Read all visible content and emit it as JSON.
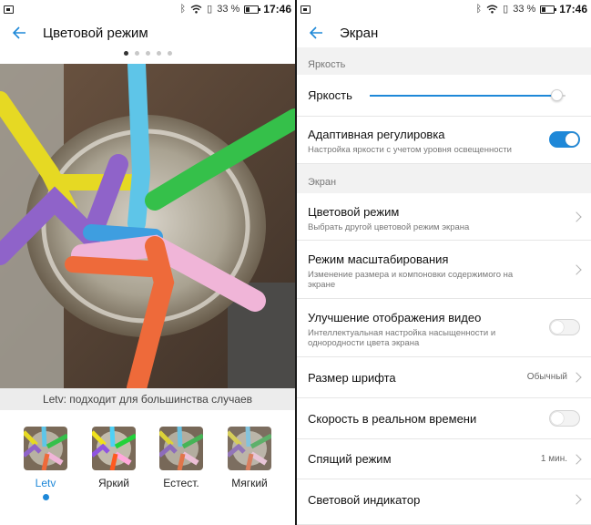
{
  "colors": {
    "accent": "#1e88d8",
    "section_bg": "#f2f2f2",
    "caption_bg": "#ececec"
  },
  "status": {
    "battery": "33 %",
    "time": "17:46",
    "icons": [
      "bluetooth-icon",
      "wifi-icon",
      "sim-icon",
      "battery-icon"
    ]
  },
  "left": {
    "title": "Цветовой режим",
    "pager_dots": 5,
    "pager_active_index": 0,
    "caption": "Letv: подходит для большинства случаев",
    "modes": [
      {
        "label": "Letv",
        "selected": true
      },
      {
        "label": "Яркий",
        "selected": false
      },
      {
        "label": "Естест.",
        "selected": false
      },
      {
        "label": "Мягкий",
        "selected": false
      }
    ]
  },
  "right": {
    "title": "Экран",
    "sections": {
      "brightness": "Яркость",
      "screen": "Экран"
    },
    "brightness_row": {
      "label": "Яркость",
      "level": 0.96
    },
    "adaptive": {
      "title": "Адаптивная регулировка",
      "subtitle": "Настройка яркости с учетом уровня освещенности",
      "on": true
    },
    "color_mode": {
      "title": "Цветовой режим",
      "subtitle": "Выбрать другой цветовой режим экрана"
    },
    "scaling": {
      "title": "Режим масштабирования",
      "subtitle": "Изменение размера и компоновки содержимого на экране"
    },
    "video": {
      "title": "Улучшение отображения видео",
      "subtitle": "Интеллектуальная настройка насыщенности и однородности цвета экрана",
      "on": false
    },
    "font_size": {
      "title": "Размер шрифта",
      "value": "Обычный"
    },
    "realtime": {
      "title": "Скорость в реальном времени",
      "on": false
    },
    "sleep": {
      "title": "Спящий режим",
      "value": "1 мин."
    },
    "indicator": {
      "title": "Световой индикатор"
    }
  }
}
